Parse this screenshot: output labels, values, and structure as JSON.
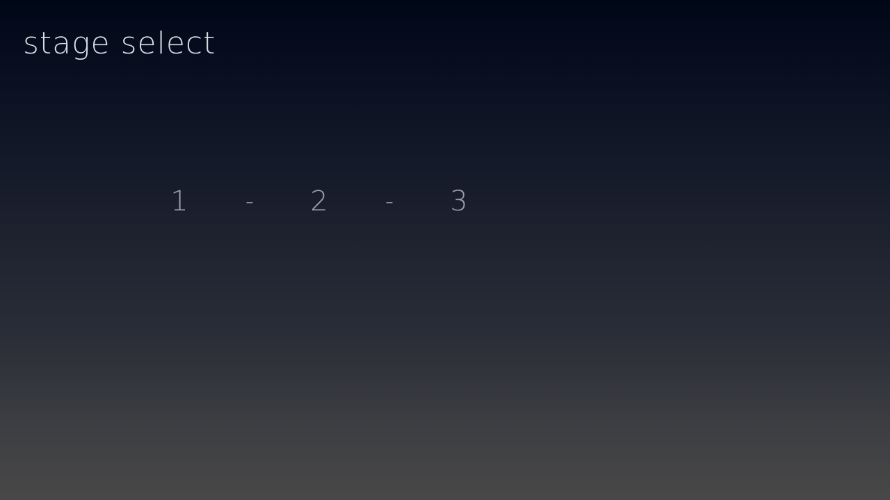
{
  "screen": {
    "title": "stage select"
  },
  "stages": [
    {
      "label": "1"
    },
    {
      "label": "2"
    },
    {
      "label": "3"
    }
  ],
  "separator": "-",
  "colors": {
    "background_top": "#000717",
    "background_bottom": "#484848",
    "title_text": "#d9dbe1",
    "stage_text": "#9ea1aa"
  }
}
